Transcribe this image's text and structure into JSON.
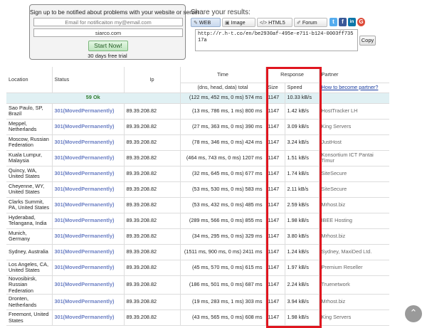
{
  "signup": {
    "title": "Sign up to be notified about problems with your website or server",
    "email_placeholder": "Email for notificaiton my@email.com",
    "site_value": "siarco.com",
    "start_label": "Start Now!",
    "trial_text": "30 days free trial"
  },
  "share": {
    "title": "Share your results:",
    "buttons": [
      {
        "label": "WEB",
        "icon": "wrench-icon"
      },
      {
        "label": "Image",
        "icon": "image-icon"
      },
      {
        "label": "HTML5",
        "icon": "code-icon"
      },
      {
        "label": "Forum",
        "icon": "pencil-icon"
      }
    ],
    "social": [
      {
        "name": "twitter",
        "glyph": "t",
        "color": "#55acee"
      },
      {
        "name": "facebook",
        "glyph": "f",
        "color": "#3b5998"
      },
      {
        "name": "linkedin",
        "glyph": "in",
        "color": "#0e76a8"
      },
      {
        "name": "google-plus",
        "glyph": "G",
        "color": "#dd4b39"
      }
    ],
    "link": "http://r.h-t.co/en/be2930af-495e-e711-b124-0003ff73517a",
    "copy_label": "Copy"
  },
  "table": {
    "headers": {
      "location": "Location",
      "status": "Status",
      "ip": "Ip",
      "time": "Time",
      "time_sub": "(dns, head, data) total",
      "response": "Response",
      "size": "Size",
      "speed": "Speed",
      "partner": "Partner",
      "partner_link": "How to become partner?"
    },
    "summary": {
      "ok": "59 Ok",
      "time": "(122 ms, 452 ms, 0 ms) 574 ms",
      "size": "1147",
      "speed": "10.33 kB/s"
    },
    "rows": [
      {
        "location": "Sao Paulo, SP, Brazil",
        "status": "301(MovedPermanently)",
        "ip": "89.39.208.82",
        "time": "(13 ms, 786 ms, 1 ms) 800 ms",
        "size": "1147",
        "speed": "1.42 kB/s",
        "partner": "HostTracker LH"
      },
      {
        "location": "Meppel, Netherlands",
        "status": "301(MovedPermanently)",
        "ip": "89.39.208.82",
        "time": "(27 ms, 363 ms, 0 ms) 390 ms",
        "size": "1147",
        "speed": "3.09 kB/s",
        "partner": "King Servers"
      },
      {
        "location": "Moscow, Russian Federation",
        "status": "301(MovedPermanently)",
        "ip": "89.39.208.82",
        "time": "(78 ms, 346 ms, 0 ms) 424 ms",
        "size": "1147",
        "speed": "3.24 kB/s",
        "partner": "JustHost"
      },
      {
        "location": "Kuala Lumpur, Malaysia",
        "status": "301(MovedPermanently)",
        "ip": "89.39.208.82",
        "time": "(464 ms, 743 ms, 0 ms) 1207 ms",
        "size": "1147",
        "speed": "1.51 kB/s",
        "partner": "Konsortium ICT Pantai Timur"
      },
      {
        "location": "Quincy, WA, United States",
        "status": "301(MovedPermanently)",
        "ip": "89.39.208.82",
        "time": "(32 ms, 645 ms, 0 ms) 677 ms",
        "size": "1147",
        "speed": "1.74 kB/s",
        "partner": "SiteSecure"
      },
      {
        "location": "Cheyenne, WY, United States",
        "status": "301(MovedPermanently)",
        "ip": "89.39.208.82",
        "time": "(53 ms, 530 ms, 0 ms) 583 ms",
        "size": "1147",
        "speed": "2.11 kB/s",
        "partner": "SiteSecure"
      },
      {
        "location": "Clarks Summit, PA, United States",
        "status": "301(MovedPermanently)",
        "ip": "89.39.208.82",
        "time": "(53 ms, 432 ms, 0 ms) 485 ms",
        "size": "1147",
        "speed": "2.59 kB/s",
        "partner": "Mrhost.biz"
      },
      {
        "location": "Hyderabad, Telangana, India",
        "status": "301(MovedPermanently)",
        "ip": "89.39.208.82",
        "time": "(289 ms, 566 ms, 0 ms) 855 ms",
        "size": "1147",
        "speed": "1.98 kB/s",
        "partner": "IBEE Hosting"
      },
      {
        "location": "Munich, Germany",
        "status": "301(MovedPermanently)",
        "ip": "89.39.208.82",
        "time": "(34 ms, 295 ms, 0 ms) 329 ms",
        "size": "1147",
        "speed": "3.80 kB/s",
        "partner": "Mrhost.biz"
      },
      {
        "location": "Sydney, Australia",
        "status": "301(MovedPermanently)",
        "ip": "89.39.208.82",
        "time": "(1511 ms, 900 ms, 0 ms) 2411 ms",
        "size": "1147",
        "speed": "1.24 kB/s",
        "partner": "Sydney, MaxiDed Ltd."
      },
      {
        "location": "Los Angeles, CA, United States",
        "status": "301(MovedPermanently)",
        "ip": "89.39.208.82",
        "time": "(45 ms, 570 ms, 0 ms) 615 ms",
        "size": "1147",
        "speed": "1.97 kB/s",
        "partner": "Premium Reseller"
      },
      {
        "location": "Novosibirsk, Russian Federation",
        "status": "301(MovedPermanently)",
        "ip": "89.39.208.82",
        "time": "(186 ms, 501 ms, 0 ms) 687 ms",
        "size": "1147",
        "speed": "2.24 kB/s",
        "partner": "Truenetwork"
      },
      {
        "location": "Dronten, Netherlands",
        "status": "301(MovedPermanently)",
        "ip": "89.39.208.82",
        "time": "(19 ms, 283 ms, 1 ms) 303 ms",
        "size": "1147",
        "speed": "3.94 kB/s",
        "partner": "Mrhost.biz"
      },
      {
        "location": "Freemont, United States",
        "status": "301(MovedPermanently)",
        "ip": "89.39.208.82",
        "time": "(43 ms, 565 ms, 0 ms) 608 ms",
        "size": "1147",
        "speed": "1.98 kB/s",
        "partner": "King Servers"
      }
    ]
  },
  "highlight_color": "#e0161f",
  "scroll_top_icon": "chevron-up-icon"
}
